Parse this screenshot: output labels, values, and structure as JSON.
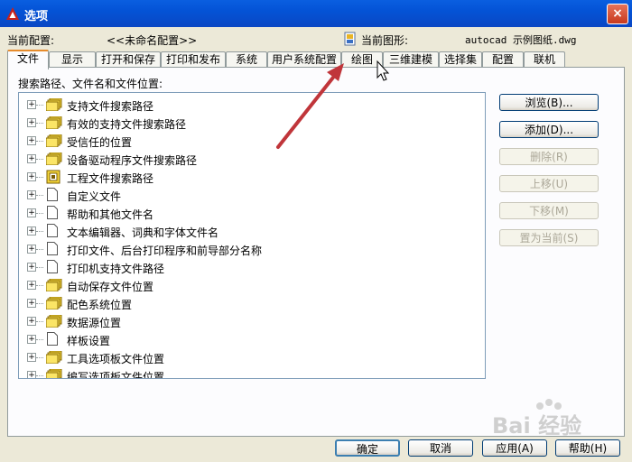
{
  "window": {
    "title": "选项",
    "close_label": "×"
  },
  "profile": {
    "label": "当前配置:",
    "value": "<<未命名配置>>"
  },
  "drawing": {
    "label": "当前图形:",
    "value": "autocad 示例图纸.dwg"
  },
  "tabs": [
    {
      "label": "文件",
      "active": true
    },
    {
      "label": "显示"
    },
    {
      "label": "打开和保存"
    },
    {
      "label": "打印和发布"
    },
    {
      "label": "系统"
    },
    {
      "label": "用户系统配置"
    },
    {
      "label": "绘图"
    },
    {
      "label": "三维建模"
    },
    {
      "label": "选择集"
    },
    {
      "label": "配置"
    },
    {
      "label": "联机"
    }
  ],
  "list_label": "搜索路径、文件名和文件位置:",
  "tree": [
    {
      "label": "支持文件搜索路径",
      "icon": "folder-stack-icon"
    },
    {
      "label": "有效的支持文件搜索路径",
      "icon": "folder-stack-icon"
    },
    {
      "label": "受信任的位置",
      "icon": "folder-stack-icon"
    },
    {
      "label": "设备驱动程序文件搜索路径",
      "icon": "folder-stack-icon"
    },
    {
      "label": "工程文件搜索路径",
      "icon": "project-icon"
    },
    {
      "label": "自定义文件",
      "icon": "document-icon"
    },
    {
      "label": "帮助和其他文件名",
      "icon": "document-icon"
    },
    {
      "label": "文本编辑器、词典和字体文件名",
      "icon": "document-icon"
    },
    {
      "label": "打印文件、后台打印程序和前导部分名称",
      "icon": "document-icon"
    },
    {
      "label": "打印机支持文件路径",
      "icon": "document-icon"
    },
    {
      "label": "自动保存文件位置",
      "icon": "folder-stack-icon"
    },
    {
      "label": "配色系统位置",
      "icon": "folder-stack-icon"
    },
    {
      "label": "数据源位置",
      "icon": "folder-stack-icon"
    },
    {
      "label": "样板设置",
      "icon": "document-icon"
    },
    {
      "label": "工具选项板文件位置",
      "icon": "folder-stack-icon"
    },
    {
      "label": "编写选项板文件位置",
      "icon": "folder-stack-icon"
    }
  ],
  "side_buttons": {
    "browse": "浏览(B)...",
    "add": "添加(D)...",
    "remove": "删除(R)",
    "move_up": "上移(U)",
    "move_down": "下移(M)",
    "set_current": "置为当前(S)"
  },
  "bottom_buttons": {
    "ok": "确定",
    "cancel": "取消",
    "apply": "应用(A)",
    "help": "帮助(H)"
  },
  "watermark": {
    "text": "Bai 经验"
  },
  "colors": {
    "annotation_arrow": "#c0353a",
    "titlebar": "#0453d6",
    "tab_highlight": "#e68b2c"
  }
}
